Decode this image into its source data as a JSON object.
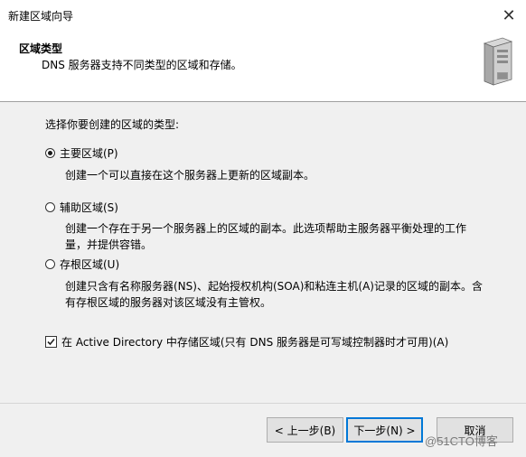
{
  "window": {
    "title": "新建区域向导",
    "close_glyph": "✕"
  },
  "header": {
    "title": "区域类型",
    "subtitle": "DNS 服务器支持不同类型的区域和存储。",
    "icon": "server-icon"
  },
  "prompt": "选择你要创建的区域的类型:",
  "options": [
    {
      "label": "主要区域(P)",
      "checked": true,
      "description": "创建一个可以直接在这个服务器上更新的区域副本。"
    },
    {
      "label": "辅助区域(S)",
      "checked": false,
      "description": "创建一个存在于另一个服务器上的区域的副本。此选项帮助主服务器平衡处理的工作量，并提供容错。"
    },
    {
      "label": "存根区域(U)",
      "checked": false,
      "description": "创建只含有名称服务器(NS)、起始授权机构(SOA)和粘连主机(A)记录的区域的副本。含有存根区域的服务器对该区域没有主管权。"
    }
  ],
  "store_ad": {
    "label": "在 Active Directory 中存储区域(只有 DNS 服务器是可写域控制器时才可用)(A)",
    "checked": true
  },
  "buttons": {
    "back": "< 上一步(B)",
    "next": "下一步(N) >",
    "cancel": "取消"
  },
  "watermark": "@51CTO博客"
}
